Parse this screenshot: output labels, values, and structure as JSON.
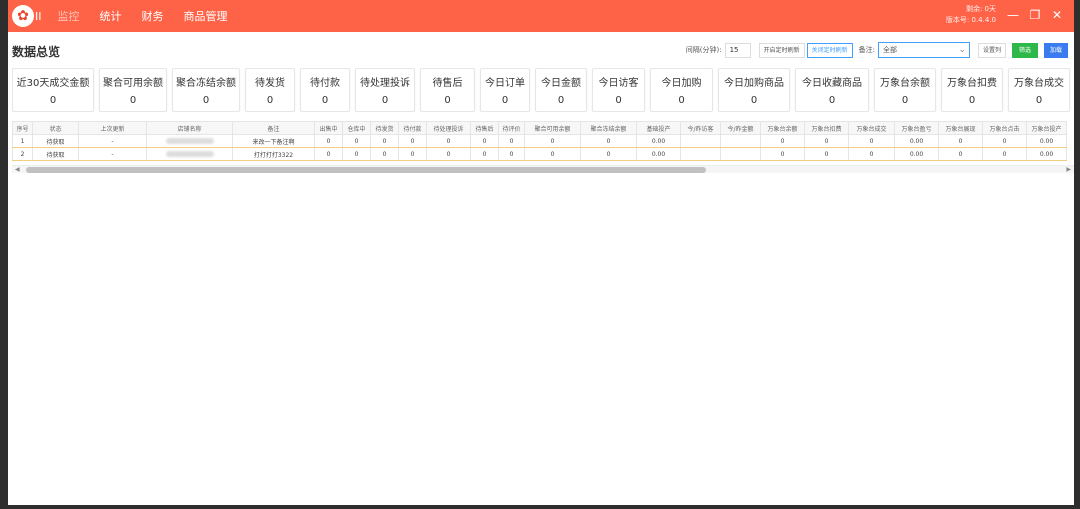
{
  "app": {
    "logo_suffix": "II"
  },
  "menu": [
    "监控",
    "统计",
    "财务",
    "商品管理"
  ],
  "titlebar_info": {
    "line1": "剩余: 0天",
    "line2": "版本号: 0.4.4.0"
  },
  "window_controls": {
    "minimize": "—",
    "maximize": "❐",
    "close": "✕"
  },
  "page_title": "数据总览",
  "toolbar": {
    "interval_label": "间隔(分钟):",
    "interval_value": "15",
    "btn_start": "开启定时刷新",
    "btn_stop": "关闭定时刷新",
    "note_label": "备注:",
    "select_value": "全部",
    "btn_set_cols": "设置列",
    "btn_filter": "筛选",
    "btn_load": "加载"
  },
  "cards": [
    {
      "label": "近30天成交金额",
      "value": "0"
    },
    {
      "label": "聚合可用余额",
      "value": "0"
    },
    {
      "label": "聚合冻结余额",
      "value": "0"
    },
    {
      "label": "待发货",
      "value": "0"
    },
    {
      "label": "待付款",
      "value": "0"
    },
    {
      "label": "待处理投诉",
      "value": "0"
    },
    {
      "label": "待售后",
      "value": "0"
    },
    {
      "label": "今日订单",
      "value": "0"
    },
    {
      "label": "今日金额",
      "value": "0"
    },
    {
      "label": "今日访客",
      "value": "0"
    },
    {
      "label": "今日加购",
      "value": "0"
    },
    {
      "label": "今日加购商品",
      "value": "0"
    },
    {
      "label": "今日收藏商品",
      "value": "0"
    },
    {
      "label": "万象台余额",
      "value": "0"
    },
    {
      "label": "万象台扣费",
      "value": "0"
    },
    {
      "label": "万象台成交",
      "value": "0"
    }
  ],
  "table": {
    "columns": [
      "序号",
      "状态",
      "上次更新",
      "店铺名称",
      "备注",
      "出售中",
      "仓库中",
      "待发货",
      "待付款",
      "待处理投诉",
      "待售后",
      "待评价",
      "聚合可用余额",
      "聚合冻结余额",
      "基础投产",
      "今/昨访客",
      "今/昨金额",
      "万象台余额",
      "万象台扣费",
      "万象台成交",
      "万象台盈亏",
      "万象台展现",
      "万象台点击",
      "万象台投产"
    ],
    "rows": [
      [
        "1",
        "待获取",
        "-",
        "",
        "来改一下备注啊",
        "0",
        "0",
        "0",
        "0",
        "0",
        "0",
        "0",
        "0",
        "0",
        "0.00",
        "",
        "",
        "0",
        "0",
        "0",
        "0.00",
        "0",
        "0",
        "0.00"
      ],
      [
        "2",
        "待获取",
        "-",
        "",
        "打打打打3322",
        "0",
        "0",
        "0",
        "0",
        "0",
        "0",
        "0",
        "0",
        "0",
        "0.00",
        "",
        "",
        "0",
        "0",
        "0",
        "0.00",
        "0",
        "0",
        "0.00"
      ]
    ]
  }
}
